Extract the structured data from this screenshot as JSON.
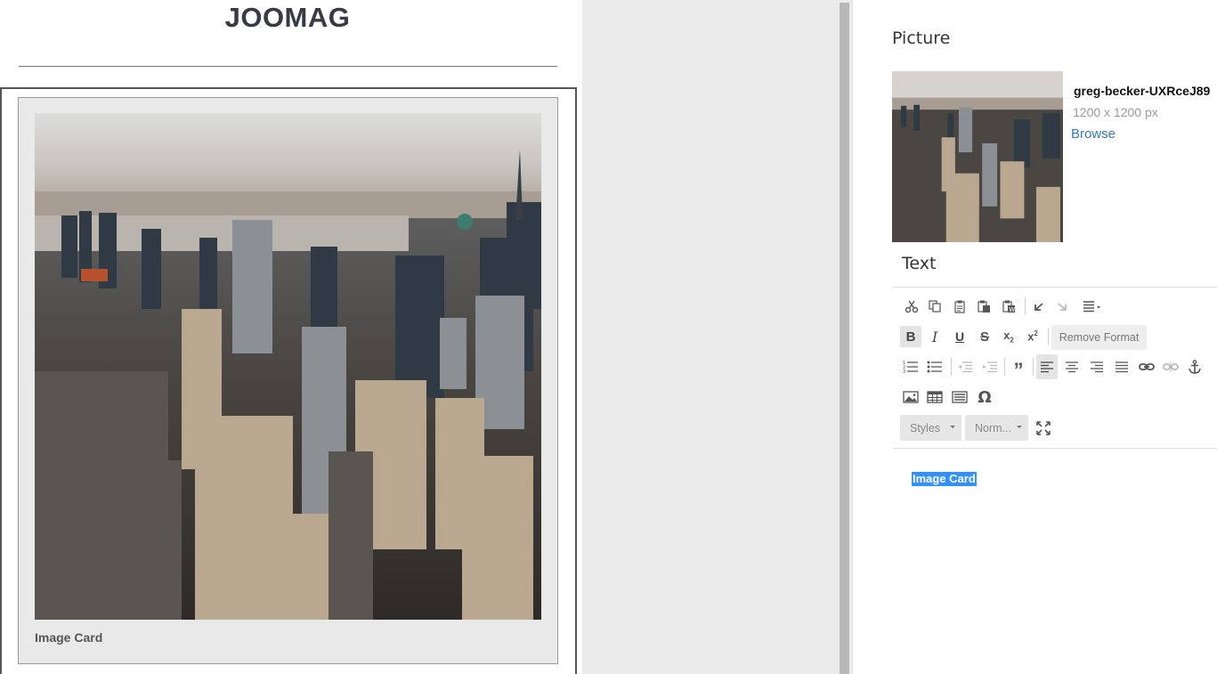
{
  "canvas": {
    "brand_title": "JOOMAG",
    "card": {
      "image_alt": "Aerial city skyline",
      "caption": "Image Card"
    }
  },
  "panel": {
    "picture_section": {
      "label": "Picture",
      "file_name": "greg-becker-UXRceJ89",
      "file_size": "1200 x 1200 px",
      "browse_label": "Browse"
    },
    "text_section": {
      "label": "Text",
      "toolbar": {
        "row1": [
          "cut-icon",
          "copy-icon",
          "paste-icon",
          "paste-text-icon",
          "paste-word-icon",
          "undo-icon",
          "redo-icon",
          "align-menu-icon"
        ],
        "row2": [
          "bold-icon",
          "italic-icon",
          "underline-icon",
          "strikethrough-icon",
          "subscript-icon",
          "superscript-icon"
        ],
        "remove_format_label": "Remove Format",
        "row3": [
          "numbered-list-icon",
          "bulleted-list-icon",
          "decrease-indent-icon",
          "increase-indent-icon",
          "blockquote-icon",
          "align-left-icon",
          "align-center-icon",
          "align-right-icon",
          "justify-icon",
          "link-icon",
          "unlink-icon",
          "anchor-icon"
        ],
        "row4": [
          "image-icon",
          "table-icon",
          "horizontal-rule-icon",
          "special-character-icon"
        ],
        "styles_label": "Styles",
        "format_label": "Norm...",
        "maximize_icon": "maximize-icon"
      },
      "editor_content": "Image Card"
    }
  },
  "colors": {
    "link": "#2f7bbf",
    "selection": "#3390ff",
    "brand": "#3a3a46"
  }
}
